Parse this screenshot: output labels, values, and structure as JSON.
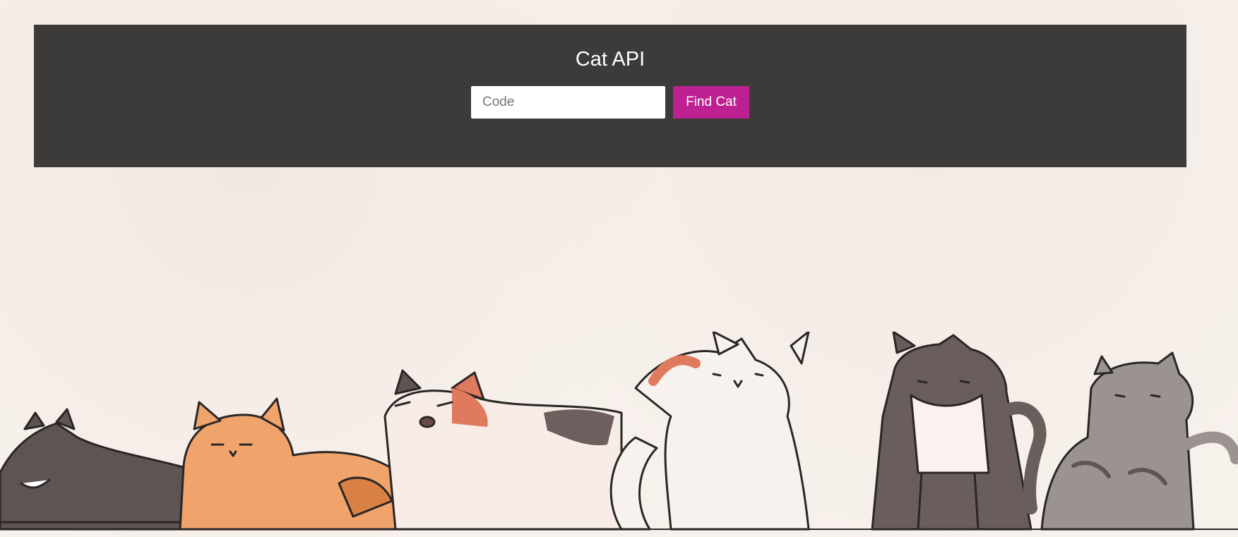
{
  "header": {
    "title": "Cat API"
  },
  "search": {
    "placeholder": "Code",
    "value": "",
    "button_label": "Find Cat"
  },
  "colors": {
    "panel_background": "#3c3b3a",
    "button_accent": "#bd2191",
    "page_background": "#f7f1ec"
  },
  "illustration": {
    "subject": "row of cartoon cats",
    "icon": "cats-illustration"
  }
}
